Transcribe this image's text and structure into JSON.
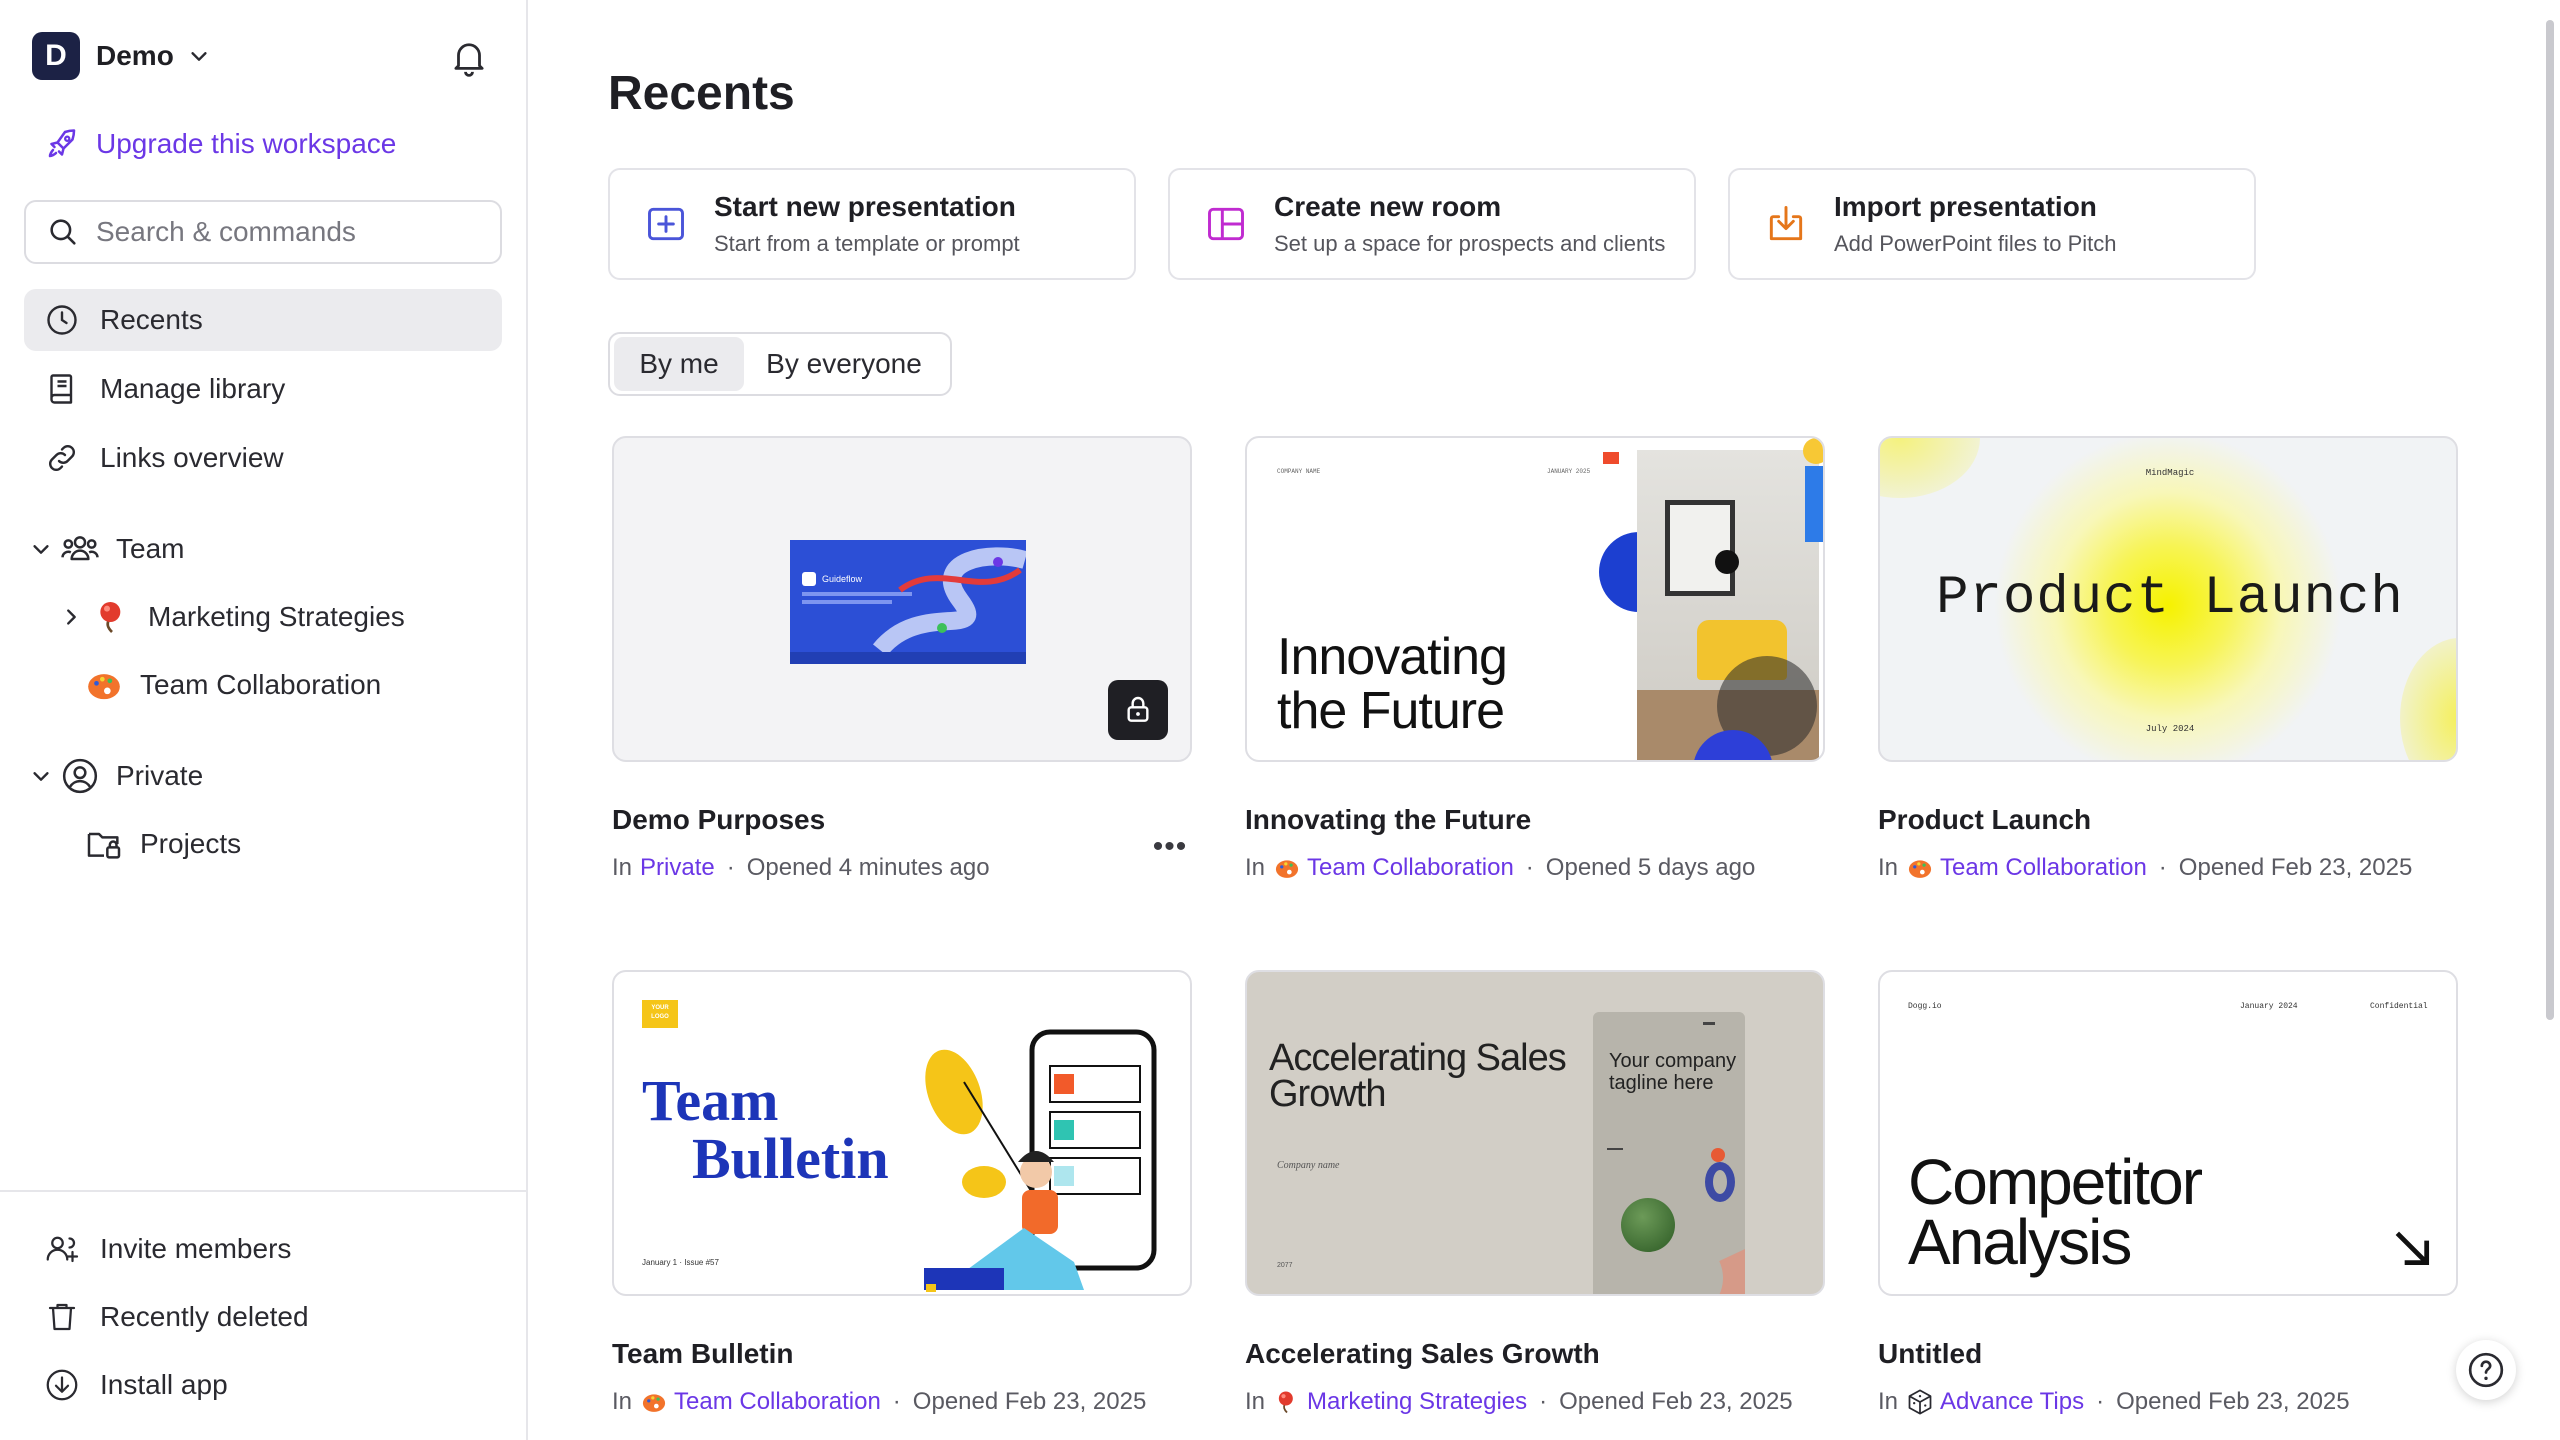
{
  "sidebar": {
    "workspace": {
      "initial": "D",
      "name": "Demo"
    },
    "upgrade_label": "Upgrade this workspace",
    "search_placeholder": "Search & commands",
    "nav": [
      {
        "label": "Recents",
        "icon": "clock-icon",
        "active": true
      },
      {
        "label": "Manage library",
        "icon": "book-icon"
      },
      {
        "label": "Links overview",
        "icon": "link-icon"
      }
    ],
    "team": {
      "label": "Team",
      "items": [
        {
          "label": "Marketing Strategies",
          "icon": "pin-emoji-icon"
        },
        {
          "label": "Team Collaboration",
          "icon": "palette-emoji-icon"
        }
      ]
    },
    "private": {
      "label": "Private",
      "items": [
        {
          "label": "Projects",
          "icon": "locked-folder-icon"
        }
      ]
    },
    "footer": [
      {
        "label": "Invite members",
        "icon": "add-user-icon"
      },
      {
        "label": "Recently deleted",
        "icon": "trash-icon"
      },
      {
        "label": "Install app",
        "icon": "download-icon"
      }
    ]
  },
  "main": {
    "title": "Recents",
    "actions": [
      {
        "title": "Start new presentation",
        "subtitle": "Start from a template or prompt",
        "color": "#4a55d9"
      },
      {
        "title": "Create new room",
        "subtitle": "Set up a space for prospects and clients",
        "color": "#c02bd0"
      },
      {
        "title": "Import presentation",
        "subtitle": "Add PowerPoint files to Pitch",
        "color": "#e5761a"
      }
    ],
    "filter": {
      "by_me": "By me",
      "by_everyone": "By everyone"
    },
    "meta_in": "In",
    "meta_dot": "·",
    "cards": [
      {
        "title": "Demo Purposes",
        "location": "Private",
        "opened": "Opened 4 minutes ago"
      },
      {
        "title": "Innovating the Future",
        "location": "Team Collaboration",
        "opened": "Opened 5 days ago"
      },
      {
        "title": "Product Launch",
        "location": "Team Collaboration",
        "opened": "Opened Feb 23, 2025"
      },
      {
        "title": "Team Bulletin",
        "location": "Team Collaboration",
        "opened": "Opened Feb 23, 2025"
      },
      {
        "title": "Accelerating Sales Growth",
        "location": "Marketing Strategies",
        "opened": "Opened Feb 23, 2025"
      },
      {
        "title": "Untitled",
        "location": "Advance Tips",
        "opened": "Opened Feb 23, 2025"
      }
    ],
    "thumbs": {
      "demo": {
        "brand": "Guideflow"
      },
      "innovating": {
        "company": "COMPANY NAME",
        "date": "JANUARY 2025",
        "headline_1": "Innovating",
        "headline_2": "the Future"
      },
      "product": {
        "brand": "MindMagic",
        "headline": "Product Launch",
        "date": "July 2024"
      },
      "bulletin": {
        "logo": "YOUR LOGO",
        "headline_1": "Team",
        "headline_2": "Bulletin",
        "footer": "January 1 · Issue #57"
      },
      "sales": {
        "headline_1": "Accelerating Sales",
        "headline_2": "Growth",
        "company": "Company name",
        "year": "2077",
        "tagline_1": "Your company",
        "tagline_2": "tagline here"
      },
      "competitor": {
        "brand": "Dogg.io",
        "date": "January 2024",
        "tag": "Confidential",
        "headline_1": "Competitor",
        "headline_2": "Analysis"
      }
    }
  }
}
